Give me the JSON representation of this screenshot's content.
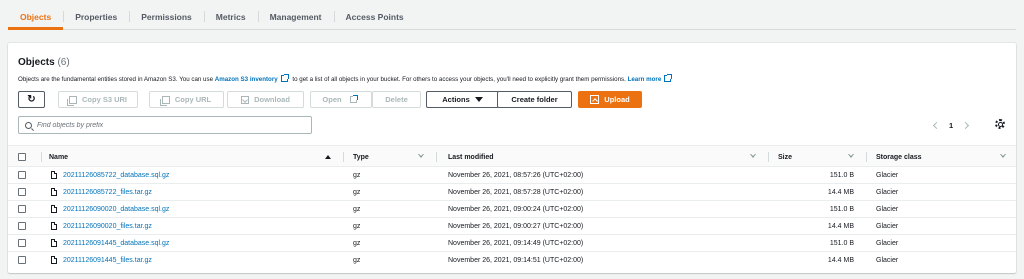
{
  "tabs": [
    "Objects",
    "Properties",
    "Permissions",
    "Metrics",
    "Management",
    "Access Points"
  ],
  "active_tab": "Objects",
  "colors": {
    "accent": "#ec7211",
    "link": "#0073bb"
  },
  "header": {
    "title": "Objects",
    "count": "(6)",
    "description_pre": "Objects are the fundamental entities stored in Amazon S3. You can use",
    "inventory_link": "Amazon S3 inventory",
    "description_mid": "to get a list of all objects in your bucket. For others to access your objects, you'll need to explicitly grant them permissions.",
    "learn_more": "Learn more"
  },
  "toolbar": {
    "refresh_icon": "refresh-icon",
    "copy_s3_uri": "Copy S3 URI",
    "copy_url": "Copy URL",
    "download": "Download",
    "open": "Open",
    "delete": "Delete",
    "actions": "Actions",
    "create_folder": "Create folder",
    "upload": "Upload"
  },
  "search": {
    "placeholder": "Find objects by prefix"
  },
  "pagination": {
    "current_page": "1"
  },
  "table": {
    "columns": {
      "name": "Name",
      "type": "Type",
      "last_modified": "Last modified",
      "size": "Size",
      "storage_class": "Storage class"
    },
    "rows": [
      {
        "name": "20211126085722_database.sql.gz",
        "type": "gz",
        "last_modified": "November 26, 2021, 08:57:26 (UTC+02:00)",
        "size": "151.0 B",
        "storage_class": "Glacier"
      },
      {
        "name": "20211126085722_files.tar.gz",
        "type": "gz",
        "last_modified": "November 26, 2021, 08:57:28 (UTC+02:00)",
        "size": "14.4 MB",
        "storage_class": "Glacier"
      },
      {
        "name": "20211126090020_database.sql.gz",
        "type": "gz",
        "last_modified": "November 26, 2021, 09:00:24 (UTC+02:00)",
        "size": "151.0 B",
        "storage_class": "Glacier"
      },
      {
        "name": "20211126090020_files.tar.gz",
        "type": "gz",
        "last_modified": "November 26, 2021, 09:00:27 (UTC+02:00)",
        "size": "14.4 MB",
        "storage_class": "Glacier"
      },
      {
        "name": "20211126091445_database.sql.gz",
        "type": "gz",
        "last_modified": "November 26, 2021, 09:14:49 (UTC+02:00)",
        "size": "151.0 B",
        "storage_class": "Glacier"
      },
      {
        "name": "20211126091445_files.tar.gz",
        "type": "gz",
        "last_modified": "November 26, 2021, 09:14:51 (UTC+02:00)",
        "size": "14.4 MB",
        "storage_class": "Glacier"
      }
    ]
  }
}
